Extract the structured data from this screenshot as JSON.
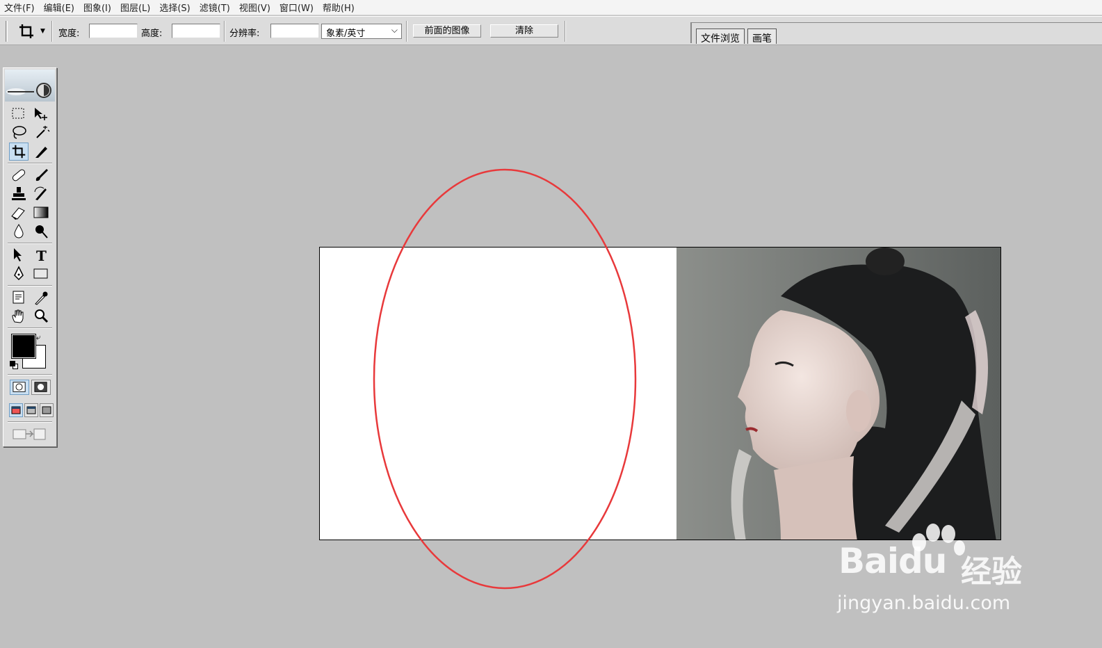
{
  "menu": {
    "items": [
      "文件(F)",
      "编辑(E)",
      "图象(I)",
      "图层(L)",
      "选择(S)",
      "滤镜(T)",
      "视图(V)",
      "窗口(W)",
      "帮助(H)"
    ]
  },
  "options": {
    "tool_icon": "crop-icon",
    "width_label": "宽度:",
    "width_value": "",
    "height_label": "高度:",
    "height_value": "",
    "resolution_label": "分辨率:",
    "resolution_value": "",
    "unit_selected": "象素/英寸",
    "front_image_button": "前面的图像",
    "clear_button": "清除"
  },
  "palette_well": {
    "tabs": [
      "文件浏览",
      "画笔"
    ]
  },
  "toolbox": {
    "active_tool": "crop-tool",
    "foreground_color": "#000000",
    "background_color": "#ffffff"
  },
  "annotation": {
    "color": "#e8393b",
    "shape": "ellipse"
  },
  "watermark": {
    "brand": "Bai",
    "brand2": "du",
    "cn": "经验",
    "url": "jingyan.baidu.com"
  }
}
